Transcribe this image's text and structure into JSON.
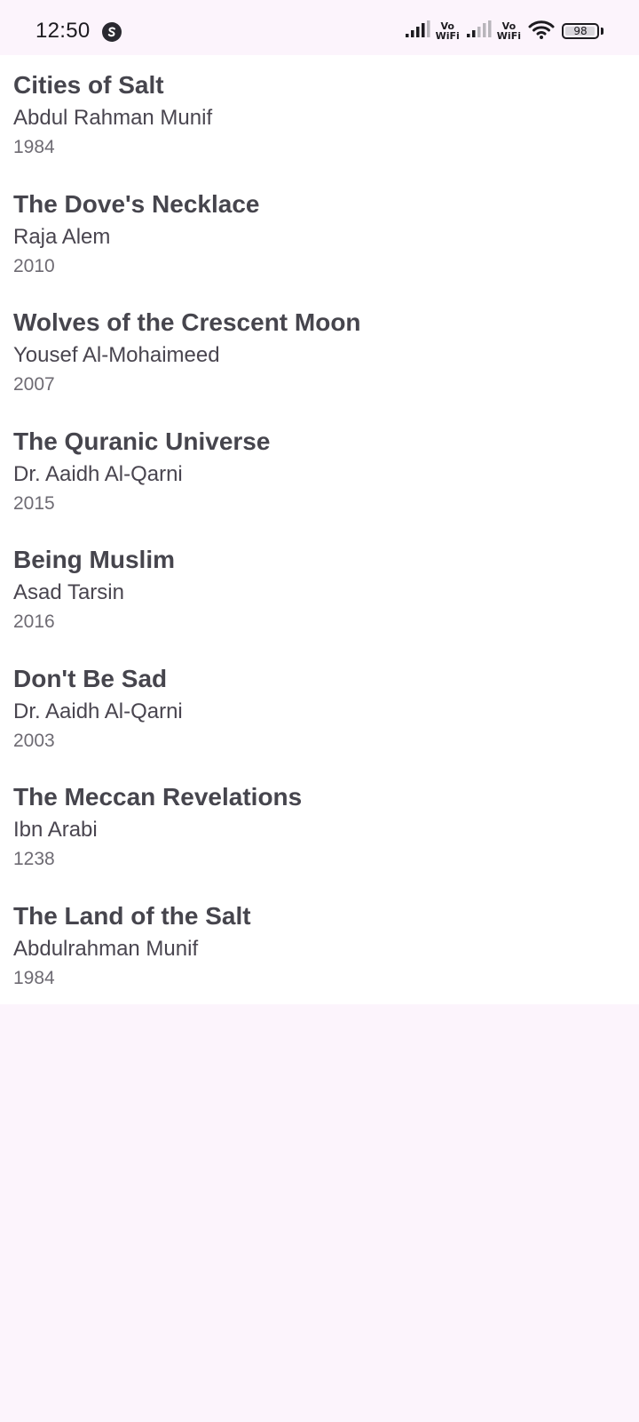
{
  "status_bar": {
    "time": "12:50",
    "network_label_1": [
      "Vo",
      "WiFi"
    ],
    "network_label_2": [
      "Vo",
      "WiFi"
    ],
    "battery_level": "98",
    "icons": [
      "app-notification-icon",
      "signal-icon",
      "signal-icon",
      "wifi-icon",
      "battery-icon"
    ]
  },
  "books": [
    {
      "title": "Cities of Salt",
      "author": "Abdul Rahman Munif",
      "year": "1984"
    },
    {
      "title": "The Dove's Necklace",
      "author": "Raja Alem",
      "year": "2010"
    },
    {
      "title": "Wolves of the Crescent Moon",
      "author": "Yousef Al-Mohaimeed",
      "year": "2007"
    },
    {
      "title": "The Quranic Universe",
      "author": "Dr. Aaidh Al-Qarni",
      "year": "2015"
    },
    {
      "title": "Being Muslim",
      "author": "Asad Tarsin",
      "year": "2016"
    },
    {
      "title": "Don't Be Sad",
      "author": "Dr. Aaidh Al-Qarni",
      "year": "2003"
    },
    {
      "title": "The Meccan Revelations",
      "author": "Ibn Arabi",
      "year": "1238"
    },
    {
      "title": "The Land of the Salt",
      "author": "Abdulrahman Munif",
      "year": "1984"
    }
  ],
  "colors": {
    "background": "#fcf4fc",
    "list_background": "#ffffff",
    "title_text": "#46454d",
    "year_text": "#6e6b73"
  }
}
